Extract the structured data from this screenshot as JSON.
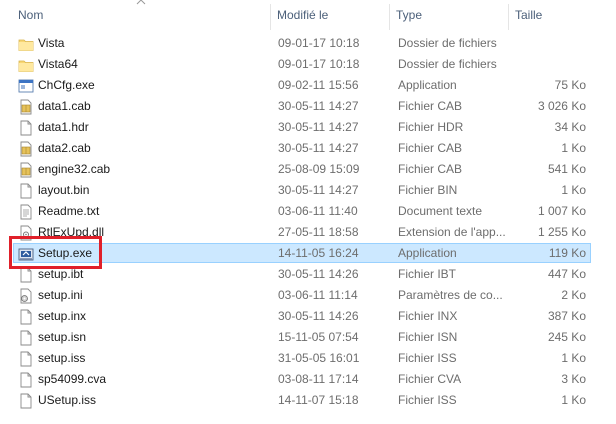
{
  "columns": {
    "name": "Nom",
    "modified": "Modifié le",
    "type": "Type",
    "size": "Taille"
  },
  "files": [
    {
      "name": "Vista",
      "modified": "09-01-17 10:18",
      "type": "Dossier de fichiers",
      "size": "",
      "icon": "folder-icon"
    },
    {
      "name": "Vista64",
      "modified": "09-01-17 10:18",
      "type": "Dossier de fichiers",
      "size": "",
      "icon": "folder-icon"
    },
    {
      "name": "ChCfg.exe",
      "modified": "09-02-11 15:56",
      "type": "Application",
      "size": "75 Ko",
      "icon": "application-icon"
    },
    {
      "name": "data1.cab",
      "modified": "30-05-11 14:27",
      "type": "Fichier CAB",
      "size": "3 026 Ko",
      "icon": "cab-file-icon"
    },
    {
      "name": "data1.hdr",
      "modified": "30-05-11 14:27",
      "type": "Fichier HDR",
      "size": "34 Ko",
      "icon": "file-icon"
    },
    {
      "name": "data2.cab",
      "modified": "30-05-11 14:27",
      "type": "Fichier CAB",
      "size": "1 Ko",
      "icon": "cab-file-icon"
    },
    {
      "name": "engine32.cab",
      "modified": "25-08-09 15:09",
      "type": "Fichier CAB",
      "size": "541 Ko",
      "icon": "cab-file-icon"
    },
    {
      "name": "layout.bin",
      "modified": "30-05-11 14:27",
      "type": "Fichier BIN",
      "size": "1 Ko",
      "icon": "file-icon"
    },
    {
      "name": "Readme.txt",
      "modified": "03-06-11 11:40",
      "type": "Document texte",
      "size": "1 007 Ko",
      "icon": "text-file-icon"
    },
    {
      "name": "RtlExUpd.dll",
      "modified": "27-05-11 18:58",
      "type": "Extension de l'app...",
      "size": "1 255 Ko",
      "icon": "dll-file-icon"
    },
    {
      "name": "Setup.exe",
      "modified": "14-11-05 16:24",
      "type": "Application",
      "size": "119 Ko",
      "icon": "setup-application-icon",
      "selected": true
    },
    {
      "name": "setup.ibt",
      "modified": "30-05-11 14:26",
      "type": "Fichier IBT",
      "size": "447 Ko",
      "icon": "file-icon"
    },
    {
      "name": "setup.ini",
      "modified": "03-06-11 11:14",
      "type": "Paramètres de co...",
      "size": "2 Ko",
      "icon": "settings-file-icon"
    },
    {
      "name": "setup.inx",
      "modified": "30-05-11 14:26",
      "type": "Fichier INX",
      "size": "387 Ko",
      "icon": "file-icon"
    },
    {
      "name": "setup.isn",
      "modified": "15-11-05 07:54",
      "type": "Fichier ISN",
      "size": "245 Ko",
      "icon": "file-icon"
    },
    {
      "name": "setup.iss",
      "modified": "31-05-05 16:01",
      "type": "Fichier ISS",
      "size": "1 Ko",
      "icon": "file-icon"
    },
    {
      "name": "sp54099.cva",
      "modified": "03-08-11 17:14",
      "type": "Fichier CVA",
      "size": "3 Ko",
      "icon": "file-icon"
    },
    {
      "name": "USetup.iss",
      "modified": "14-11-07 15:18",
      "type": "Fichier ISS",
      "size": "1 Ko",
      "icon": "file-icon"
    }
  ],
  "colors": {
    "selection_bg": "#cce8ff",
    "selection_border": "#99d1ff",
    "folder": "#f8d775",
    "highlight": "#e0202a"
  }
}
